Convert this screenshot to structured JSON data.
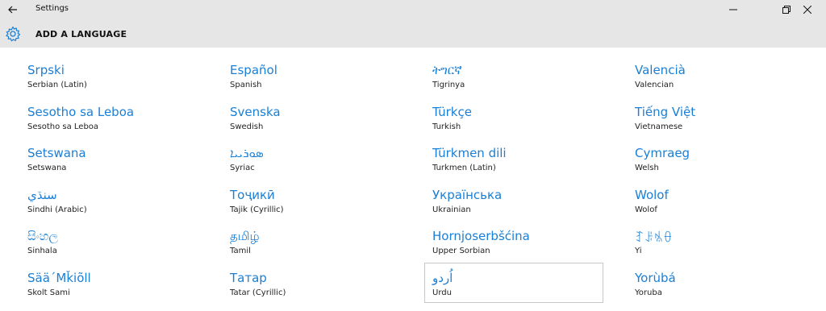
{
  "window": {
    "title": "Settings"
  },
  "header": {
    "title": "ADD A LANGUAGE"
  },
  "columns": [
    [
      {
        "native": "Srpski",
        "english": "Serbian (Latin)"
      },
      {
        "native": "Sesotho sa Leboa",
        "english": "Sesotho sa Leboa"
      },
      {
        "native": "Setswana",
        "english": "Setswana"
      },
      {
        "native": "سنڌي",
        "english": "Sindhi (Arabic)"
      },
      {
        "native": "සිංහල",
        "english": "Sinhala"
      },
      {
        "native": "Sää´Mǩiõll",
        "english": "Skolt Sami"
      }
    ],
    [
      {
        "native": "Español",
        "english": "Spanish"
      },
      {
        "native": "Svenska",
        "english": "Swedish"
      },
      {
        "native": "ܣܘܪܝܝܐ",
        "english": "Syriac"
      },
      {
        "native": "Тоҷикӣ",
        "english": "Tajik (Cyrillic)"
      },
      {
        "native": "தமிழ்",
        "english": "Tamil"
      },
      {
        "native": "Татар",
        "english": "Tatar (Cyrillic)"
      }
    ],
    [
      {
        "native": "ትግርኛ",
        "english": "Tigrinya"
      },
      {
        "native": "Türkçe",
        "english": "Turkish"
      },
      {
        "native": "Türkmen dili",
        "english": "Turkmen (Latin)"
      },
      {
        "native": "Українська",
        "english": "Ukrainian"
      },
      {
        "native": "Hornjoserbšćina",
        "english": "Upper Sorbian"
      },
      {
        "native": "اُردو",
        "english": "Urdu"
      }
    ],
    [
      {
        "native": "Valencià",
        "english": "Valencian"
      },
      {
        "native": "Tiếng Việt",
        "english": "Vietnamese"
      },
      {
        "native": "Cymraeg",
        "english": "Welsh"
      },
      {
        "native": "Wolof",
        "english": "Wolof"
      },
      {
        "native": "ꆈꌠꁱꂷ",
        "english": "Yi"
      },
      {
        "native": "Yorùbá",
        "english": "Yoruba"
      }
    ]
  ],
  "colors": {
    "accent": "#1a7fd6",
    "header_bg": "#e6e6e6"
  },
  "icons": {
    "back": "back-arrow-icon",
    "settings": "gear-icon"
  }
}
